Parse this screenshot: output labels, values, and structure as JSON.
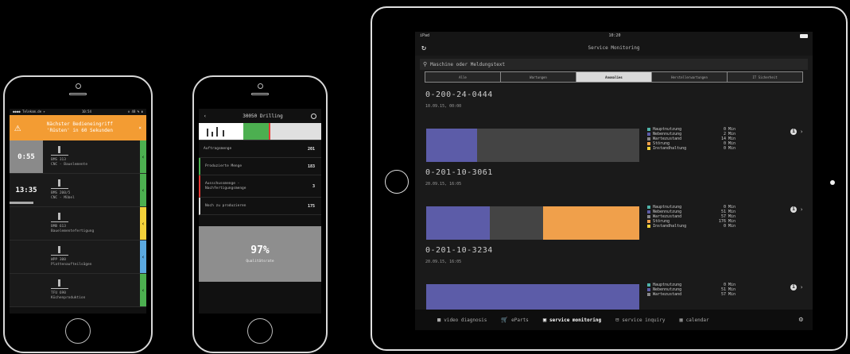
{
  "colors": {
    "purple": "#5c5ca8",
    "darkgrey": "#444444",
    "orange": "#f0a04b",
    "green": "#4caf50",
    "yellow": "#f3d13a",
    "blue": "#5ba9e0",
    "red": "#e53935",
    "alert": "#f39c33"
  },
  "phone1": {
    "status": {
      "carrier": "●●●● Telekom.de ✈",
      "time": "10:54",
      "battery": "⊙ 48 % ▮"
    },
    "alert": {
      "icon": "warning-icon",
      "line1": "Nächster Bedieneingriff",
      "line2": "'Rüsten' in 60 Sekunden",
      "close": "×"
    },
    "rows": [
      {
        "timer": "0:55",
        "name": "BMS 313",
        "sub": "CNC - Bauelemente",
        "color": "#4caf50",
        "timer_bg": "grey"
      },
      {
        "timer": "13:35",
        "name": "BMS 200/5",
        "sub": "CNC - Möbel",
        "color": "#4caf50",
        "timer_bg": "none",
        "progress": true
      },
      {
        "timer": "",
        "name": "BMB 613",
        "sub": "Bauelementefertigung",
        "color": "#f3d13a",
        "timer_bg": "none"
      },
      {
        "timer": "",
        "name": "WPP 300",
        "sub": "Plattenaufteilsägen",
        "color": "#5ba9e0",
        "timer_bg": "none"
      },
      {
        "timer": "",
        "name": "TFU 690",
        "sub": "Küchenproduktion",
        "color": "#4caf50",
        "timer_bg": "none"
      }
    ]
  },
  "phone2": {
    "header": {
      "back": "‹",
      "title": "30050 Drilling"
    },
    "rows": [
      {
        "label": "Auftragsmenge",
        "value": "201",
        "accent": "none"
      },
      {
        "label": "Produzierte Menge",
        "value": "183",
        "accent": "green"
      },
      {
        "label": "Ausschussmenge - Nachfertigungsmenge",
        "value": "3",
        "accent": "red"
      },
      {
        "label": "Noch zu produzieren",
        "value": "175",
        "accent": "white"
      }
    ],
    "quality": {
      "value": "97%",
      "label": "Qualitätsrate"
    },
    "pager": "• • ● •"
  },
  "ipad": {
    "status": {
      "device": "iPad",
      "time": "10:20"
    },
    "title": "Service Monitoring",
    "search_placeholder": "Maschine oder Meldungstext",
    "segments": [
      {
        "label": "Alle",
        "active": false
      },
      {
        "label": "Wartungen",
        "active": false
      },
      {
        "label": "Anomalies",
        "active": true
      },
      {
        "label": "Herstellerwartungen",
        "active": false
      },
      {
        "label": "IT Sicherheit",
        "active": false
      }
    ],
    "machines": [
      {
        "id": "0-200-24-0444",
        "date": "10.09.15, 00:00",
        "bar": [
          {
            "color": "#5c5ca8",
            "pct": 24
          },
          {
            "color": "#444444",
            "pct": 76
          }
        ],
        "legend": [
          {
            "label": "Hauptnutzung",
            "value": "0 Min",
            "color": "#4fb3a9"
          },
          {
            "label": "Nebennutzung",
            "value": "2 Min",
            "color": "#5c5ca8"
          },
          {
            "label": "Wartezustand",
            "value": "14 Min",
            "color": "#888888"
          },
          {
            "label": "Störung",
            "value": "0 Min",
            "color": "#f0a04b"
          },
          {
            "label": "Instandhaltung",
            "value": "0 Min",
            "color": "#f3d13a"
          }
        ]
      },
      {
        "id": "0-201-10-3061",
        "date": "20.09.15, 16:05",
        "bar": [
          {
            "color": "#5c5ca8",
            "pct": 30
          },
          {
            "color": "#444444",
            "pct": 25
          },
          {
            "color": "#f0a04b",
            "pct": 45
          }
        ],
        "legend": [
          {
            "label": "Hauptnutzung",
            "value": "0 Min",
            "color": "#4fb3a9"
          },
          {
            "label": "Nebennutzung",
            "value": "51 Min",
            "color": "#5c5ca8"
          },
          {
            "label": "Wartezustand",
            "value": "57 Min",
            "color": "#888888"
          },
          {
            "label": "Störung",
            "value": "176 Min",
            "color": "#f0a04b"
          },
          {
            "label": "Instandhaltung",
            "value": "0 Min",
            "color": "#f3d13a"
          }
        ]
      },
      {
        "id": "0-201-10-3234",
        "date": "20.09.15, 16:05",
        "bar": [
          {
            "color": "#5c5ca8",
            "pct": 100
          }
        ],
        "legend": [
          {
            "label": "Hauptnutzung",
            "value": "0 Min",
            "color": "#4fb3a9"
          },
          {
            "label": "Nebennutzung",
            "value": "51 Min",
            "color": "#5c5ca8"
          },
          {
            "label": "Wartezustand",
            "value": "57 Min",
            "color": "#888888"
          }
        ]
      }
    ],
    "tabs": [
      {
        "icon": "video-camera-icon",
        "glyph": "■",
        "label": "video diagnosis",
        "active": false
      },
      {
        "icon": "cart-icon",
        "glyph": "🛒",
        "label": "eParts",
        "active": false
      },
      {
        "icon": "monitor-icon",
        "glyph": "▣",
        "label": "service monitoring",
        "active": true
      },
      {
        "icon": "inquiry-icon",
        "glyph": "⊟",
        "label": "service inquiry",
        "active": false
      },
      {
        "icon": "calendar-icon",
        "glyph": "▦",
        "label": "calendar",
        "active": false
      }
    ],
    "settings_icon": "gear-icon"
  }
}
